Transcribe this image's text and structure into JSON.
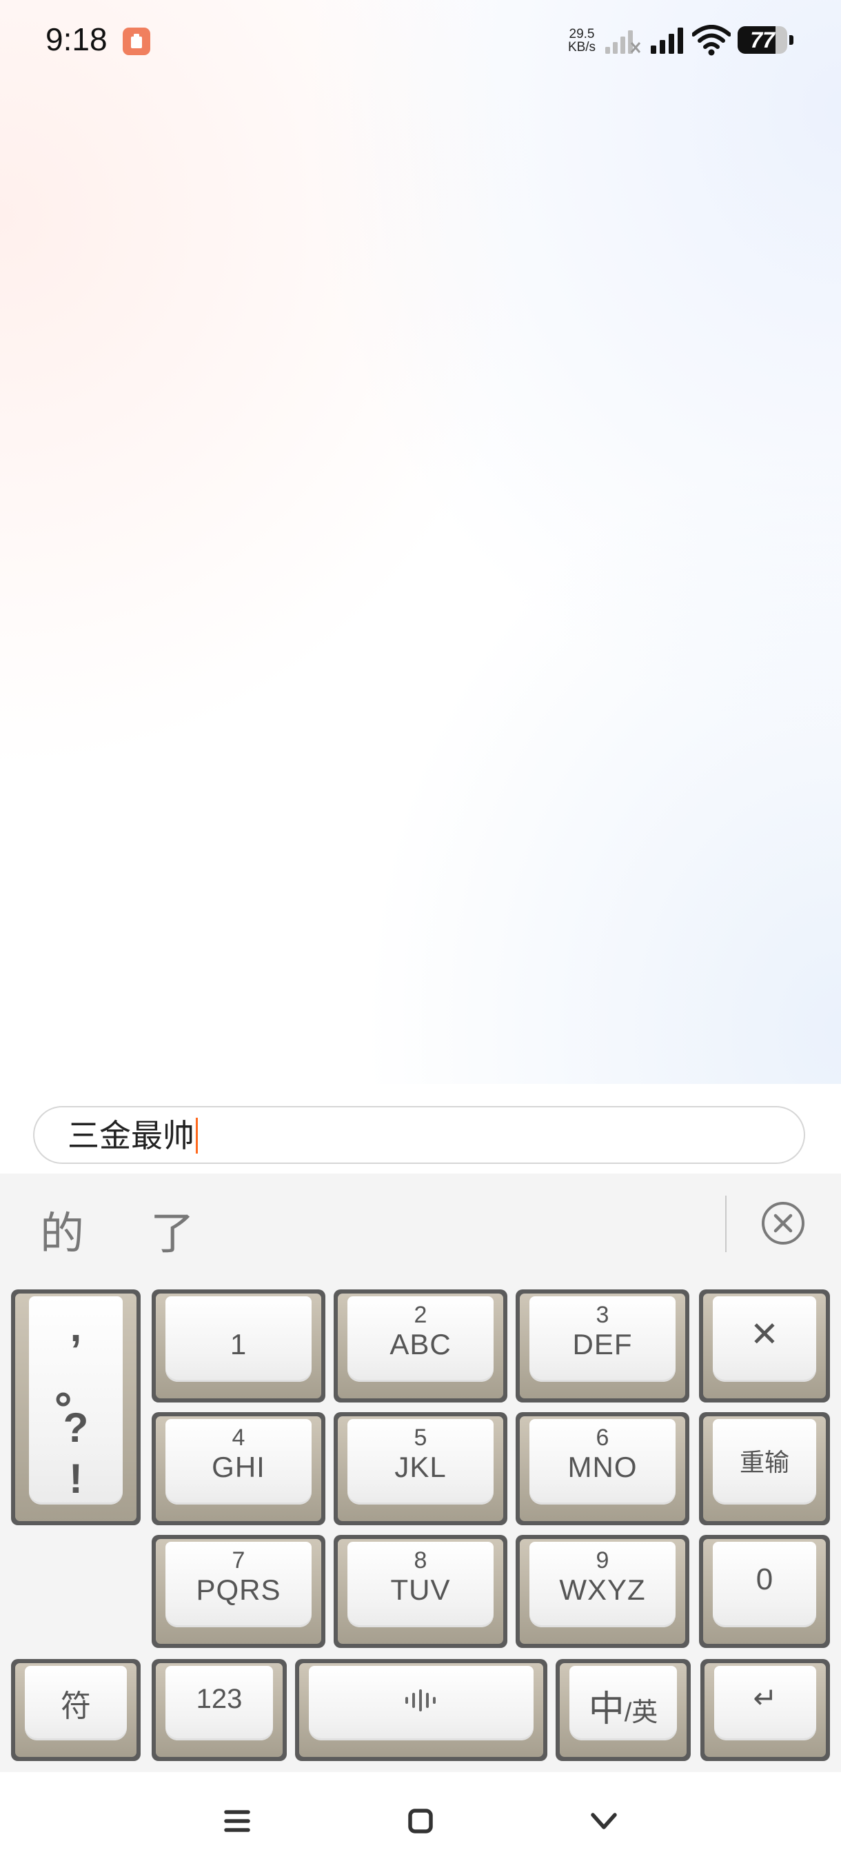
{
  "status_bar": {
    "time": "9:18",
    "net_speed_value": "29.5",
    "net_speed_unit": "KB/s",
    "battery_level": "77",
    "icons": [
      "app-notification-icon",
      "signal-sim2-icon",
      "signal-sim1-icon",
      "wifi-icon",
      "battery-icon"
    ]
  },
  "input": {
    "value": "三金最帅"
  },
  "keyboard": {
    "candidates": [
      "的",
      "了"
    ],
    "punctuation": [
      ",",
      "。",
      "?",
      "!"
    ],
    "keys": {
      "k1": {
        "num": "",
        "letters": "1"
      },
      "k2": {
        "num": "2",
        "letters": "ABC"
      },
      "k3": {
        "num": "3",
        "letters": "DEF"
      },
      "k4": {
        "num": "4",
        "letters": "GHI"
      },
      "k5": {
        "num": "5",
        "letters": "JKL"
      },
      "k6": {
        "num": "6",
        "letters": "MNO"
      },
      "k7": {
        "num": "7",
        "letters": "PQRS"
      },
      "k8": {
        "num": "8",
        "letters": "TUV"
      },
      "k9": {
        "num": "9",
        "letters": "WXYZ"
      },
      "k0": "0"
    },
    "delete": "✕",
    "retype": "重输",
    "symbols": "符",
    "num_mode": "123",
    "lang_cn": "中",
    "lang_sep": "/英",
    "enter": "↵"
  },
  "nav": {
    "icons": [
      "menu-icon",
      "home-icon",
      "back-icon"
    ]
  },
  "colors": {
    "caret": "#ff6a1f",
    "notification": "#f07f5e",
    "keyboard_bg": "#f4f4f4"
  }
}
